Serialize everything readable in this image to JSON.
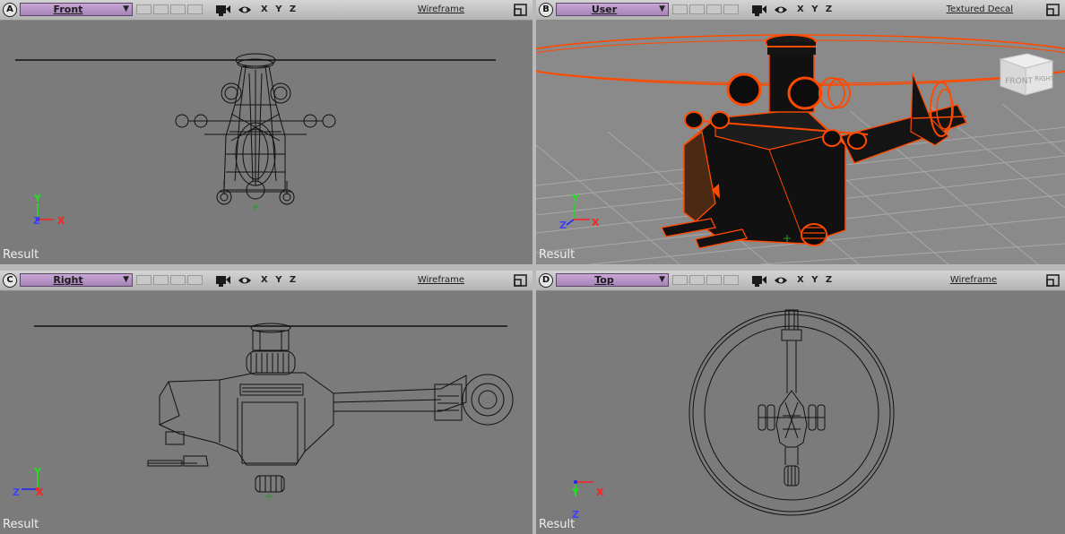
{
  "viewports": {
    "a": {
      "letter": "A",
      "name": "Front",
      "mode": "Wireframe",
      "result": "Result",
      "axes": {
        "up": "Y",
        "right": "X",
        "depth": "Z"
      }
    },
    "b": {
      "letter": "B",
      "name": "User",
      "mode": "Textured Decal",
      "result": "Result",
      "axes": {
        "up": "Y",
        "right": "X",
        "depth": "Z"
      },
      "viewcube": {
        "front": "FRONT",
        "right": "RIGHT"
      }
    },
    "c": {
      "letter": "C",
      "name": "Right",
      "mode": "Wireframe",
      "result": "Result",
      "axes": {
        "up": "Y",
        "right": "X",
        "depth": "Z"
      }
    },
    "d": {
      "letter": "D",
      "name": "Top",
      "mode": "Wireframe",
      "result": "Result",
      "axes": {
        "up": "Y",
        "right": "X",
        "depth": "Z"
      }
    }
  },
  "header": {
    "xyz": "X Y Z",
    "dropdown_caret": "▼"
  },
  "colors": {
    "viewport_bg": "#7b7b7b",
    "active_frame": "#d7d7d7",
    "wire": "#111111",
    "highlight": "#ff4a00",
    "axis_x": "#ff2020",
    "axis_y": "#20e020",
    "axis_z": "#2020ff"
  }
}
